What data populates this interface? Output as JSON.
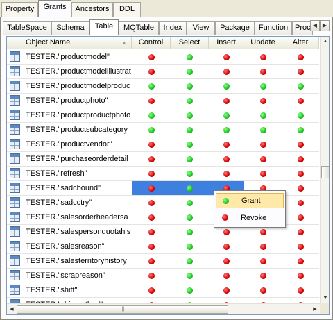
{
  "top_tabs": [
    "Property",
    "Grants",
    "Ancestors",
    "DDL"
  ],
  "sub_tabs": [
    "TableSpace",
    "Schema",
    "Table",
    "MQTable",
    "Index",
    "View",
    "Package",
    "Function",
    "Proc"
  ],
  "grid": {
    "columns": [
      "Object Name",
      "Control",
      "Select",
      "Insert",
      "Update",
      "Alter"
    ],
    "rows": [
      {
        "name": "TESTER.\"productmodel\"",
        "grants": [
          "red",
          "green",
          "red",
          "red",
          "red"
        ]
      },
      {
        "name": "TESTER.\"productmodelillustrat",
        "grants": [
          "red",
          "green",
          "red",
          "red",
          "red"
        ]
      },
      {
        "name": "TESTER.\"productmodelproduc",
        "grants": [
          "green",
          "green",
          "green",
          "green",
          "green"
        ]
      },
      {
        "name": "TESTER.\"productphoto\"",
        "grants": [
          "red",
          "green",
          "red",
          "red",
          "red"
        ]
      },
      {
        "name": "TESTER.\"productproductphoto",
        "grants": [
          "green",
          "green",
          "green",
          "green",
          "green"
        ]
      },
      {
        "name": "TESTER.\"productsubcategory",
        "grants": [
          "green",
          "green",
          "green",
          "green",
          "green"
        ]
      },
      {
        "name": "TESTER.\"productvendor\"",
        "grants": [
          "red",
          "green",
          "red",
          "red",
          "red"
        ]
      },
      {
        "name": "TESTER.\"purchaseorderdetail",
        "grants": [
          "red",
          "green",
          "red",
          "red",
          "red"
        ]
      },
      {
        "name": "TESTER.\"refresh\"",
        "grants": [
          "red",
          "green",
          "red",
          "red",
          "red"
        ]
      },
      {
        "name": "TESTER.\"sadcbound\"",
        "grants": [
          "red",
          "green",
          "red",
          "red",
          "red"
        ]
      },
      {
        "name": "TESTER.\"sadcctry\"",
        "grants": [
          "red",
          "green",
          "red",
          "red",
          "red"
        ]
      },
      {
        "name": "TESTER.\"salesorderheadersa",
        "grants": [
          "red",
          "green",
          "red",
          "red",
          "red"
        ]
      },
      {
        "name": "TESTER.\"salespersonquotahis",
        "grants": [
          "red",
          "green",
          "red",
          "red",
          "red"
        ]
      },
      {
        "name": "TESTER.\"salesreason\"",
        "grants": [
          "red",
          "green",
          "red",
          "red",
          "red"
        ]
      },
      {
        "name": "TESTER.\"salesterritoryhistory",
        "grants": [
          "red",
          "green",
          "red",
          "red",
          "red"
        ]
      },
      {
        "name": "TESTER.\"scrapreason\"",
        "grants": [
          "red",
          "green",
          "red",
          "red",
          "red"
        ]
      },
      {
        "name": "TESTER.\"shift\"",
        "grants": [
          "red",
          "green",
          "red",
          "red",
          "red"
        ]
      },
      {
        "name": "TESTER.\"shipmethod\"",
        "grants": [
          "red",
          "green",
          "red",
          "red",
          "red"
        ]
      }
    ]
  },
  "context_menu": {
    "items": [
      {
        "label": "Grant",
        "state": "green"
      },
      {
        "label": "Revoke",
        "state": "red"
      }
    ]
  }
}
